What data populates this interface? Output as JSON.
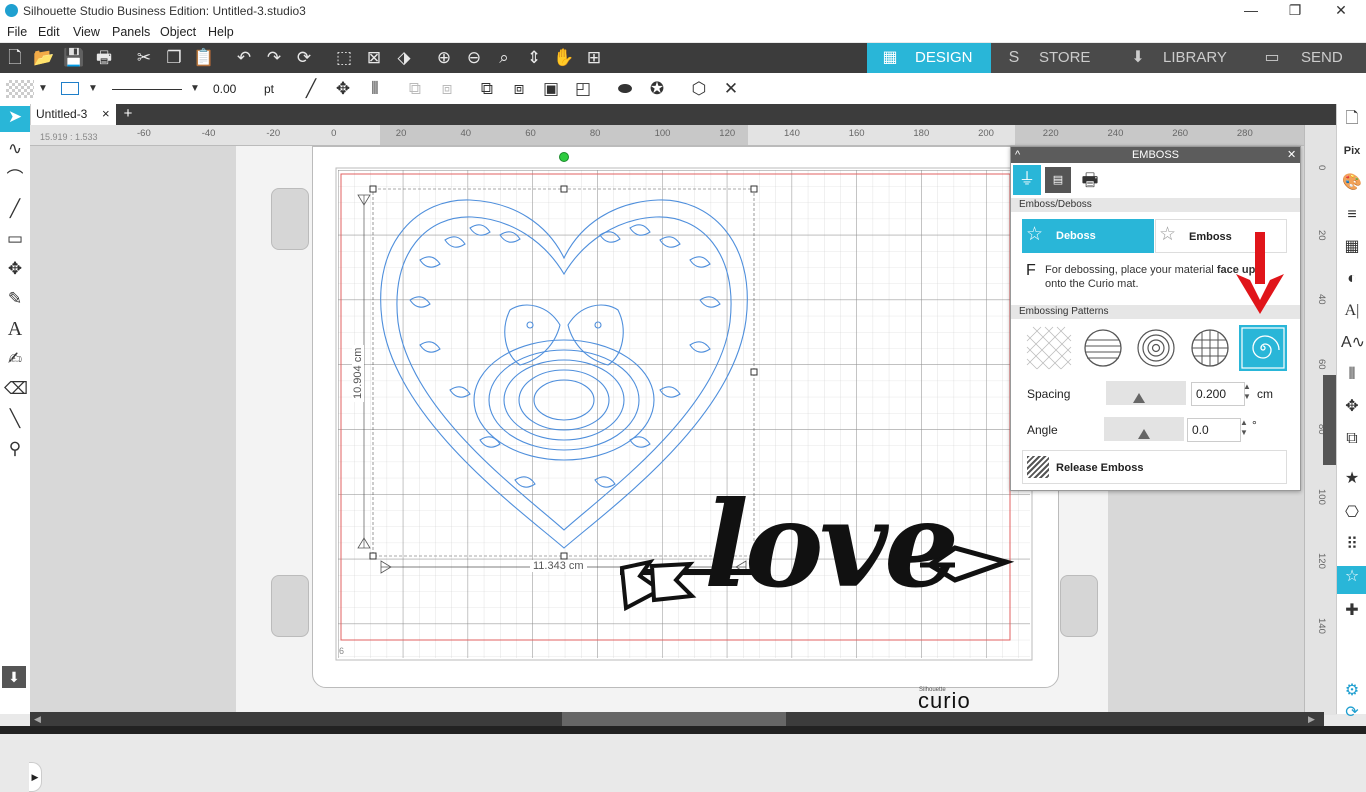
{
  "window": {
    "title": "Silhouette Studio Business Edition: Untitled-3.studio3",
    "controls": [
      "—",
      "❐",
      "✕"
    ]
  },
  "menu": [
    "File",
    "Edit",
    "View",
    "Panels",
    "Object",
    "Help"
  ],
  "nav_tabs": [
    {
      "label": "DESIGN",
      "icon": "grid-icon",
      "active": true
    },
    {
      "label": "STORE",
      "icon": "store-icon",
      "active": false
    },
    {
      "label": "LIBRARY",
      "icon": "library-icon",
      "active": false
    },
    {
      "label": "SEND",
      "icon": "send-icon",
      "active": false
    }
  ],
  "line_style": {
    "weight": "0.00",
    "unit": "pt"
  },
  "document_tab": {
    "name": "Untitled-3",
    "close": "×",
    "add": "+"
  },
  "cursor_coords": "15.919 : 1.533",
  "ruler": {
    "horizontal": [
      "-60",
      "-40",
      "-20",
      "0",
      "20",
      "40",
      "60",
      "80",
      "100",
      "120",
      "140",
      "160",
      "180",
      "200",
      "220",
      "240",
      "260",
      "280"
    ],
    "vertical": [
      "0",
      "20",
      "40",
      "60",
      "80",
      "100",
      "120",
      "140"
    ]
  },
  "canvas": {
    "height_label": "10.904 cm",
    "width_label": "11.343 cm",
    "mat_corner": "6",
    "design_text": "love",
    "brand_small": "Silhouette",
    "brand": "curio"
  },
  "emboss_panel": {
    "title": "EMBOSS",
    "close": "✕",
    "section_emboss": "Emboss/Deboss",
    "deboss_label": "Deboss",
    "emboss_label": "Emboss",
    "mode_active": "deboss",
    "hint_letter": "F",
    "hint_text_1": "For debossing, place your material",
    "hint_bold": "face up",
    "hint_text_2": "onto the Curio mat.",
    "section_patterns": "Embossing Patterns",
    "patterns": [
      "crosshatch",
      "horizontal-lines",
      "concentric-circles",
      "grid-circle",
      "spiral"
    ],
    "selected_pattern": "spiral",
    "spacing_label": "Spacing",
    "spacing_value": "0.200",
    "spacing_unit": "cm",
    "angle_label": "Angle",
    "angle_value": "0.0",
    "angle_unit": "°",
    "release_label": "Release Emboss"
  },
  "colors": {
    "accent": "#29b6d8",
    "toolbar": "#3c3c3c",
    "design_blue": "#4f8fdc",
    "arrow_red": "#e0151a",
    "mat_grid": "#888888",
    "cut_border": "#e06060"
  }
}
